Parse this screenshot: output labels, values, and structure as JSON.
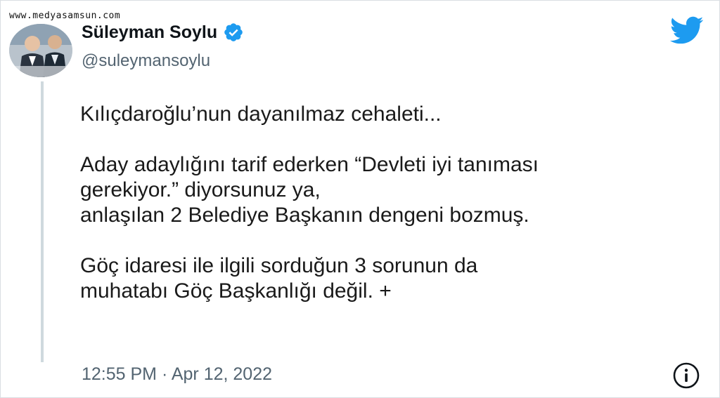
{
  "watermark": "www.medyasamsun.com",
  "author": {
    "display_name": "Süleyman Soylu",
    "handle": "@suleymansoylu",
    "verified": true,
    "verified_icon": "verified-badge-icon",
    "avatar_icon": "avatar-photo"
  },
  "brand_icon": "twitter-bird-icon",
  "tweet": {
    "paragraphs": [
      {
        "lines": [
          "Kılıçdaroğlu’nun dayanılmaz cehaleti..."
        ]
      },
      {
        "lines": [
          "Aday adaylığını tarif ederken “Devleti iyi tanıması",
          "gerekiyor.” diyorsunuz ya,",
          "anlaşılan 2 Belediye Başkanın dengeni bozmuş."
        ]
      },
      {
        "lines": [
          "Göç idaresi ile ilgili sorduğun 3 sorunun da",
          "muhatabı Göç Başkanlığı değil. +"
        ]
      }
    ],
    "timestamp": "12:55 PM · Apr 12, 2022"
  },
  "info_icon": "info-icon",
  "colors": {
    "twitter_blue": "#1d9bf0",
    "text_primary": "#0f1419",
    "text_secondary": "#536471",
    "thread_line": "#cfd9de"
  }
}
